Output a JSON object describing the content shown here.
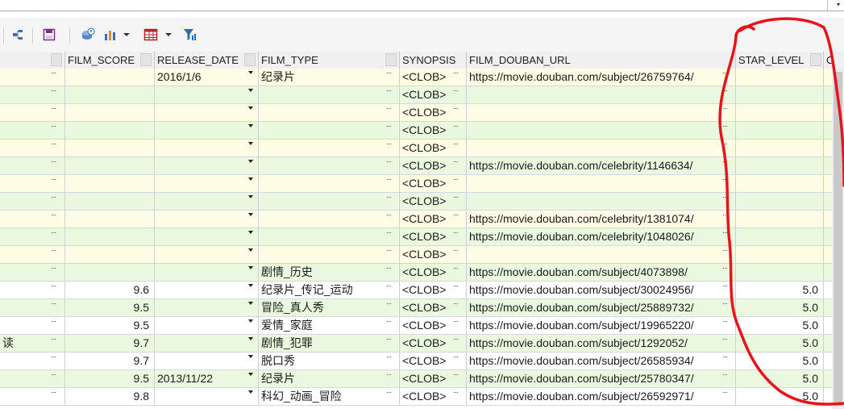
{
  "toolbar": {
    "icons": [
      "diagram-icon",
      "save-icon",
      "refresh-info-icon",
      "chart-icon",
      "dropdown-arrow-icon",
      "table-icon",
      "dropdown-arrow-icon",
      "filter-icon"
    ]
  },
  "grid": {
    "columns": [
      "FILM_SCORE",
      "RELEASE_DATE",
      "FILM_TYPE",
      "SYNOPSIS",
      "FILM_DOUBAN_URL",
      "STAR_LEVEL",
      "C"
    ],
    "rows": [
      {
        "lead": "",
        "score": "",
        "date": "2016/1/6",
        "type": "纪录片",
        "synopsis": "<CLOB>",
        "url": "https://movie.douban.com/subject/26759764/",
        "star": ""
      },
      {
        "lead": "",
        "score": "",
        "date": "",
        "type": "",
        "synopsis": "<CLOB>",
        "url": "",
        "star": ""
      },
      {
        "lead": "",
        "score": "",
        "date": "",
        "type": "",
        "synopsis": "<CLOB>",
        "url": "",
        "star": ""
      },
      {
        "lead": "",
        "score": "",
        "date": "",
        "type": "",
        "synopsis": "<CLOB>",
        "url": "",
        "star": ""
      },
      {
        "lead": "",
        "score": "",
        "date": "",
        "type": "",
        "synopsis": "<CLOB>",
        "url": "",
        "star": ""
      },
      {
        "lead": "",
        "score": "",
        "date": "",
        "type": "",
        "synopsis": "<CLOB>",
        "url": "https://movie.douban.com/celebrity/1146634/",
        "star": ""
      },
      {
        "lead": "",
        "score": "",
        "date": "",
        "type": "",
        "synopsis": "<CLOB>",
        "url": "",
        "star": ""
      },
      {
        "lead": "",
        "score": "",
        "date": "",
        "type": "",
        "synopsis": "<CLOB>",
        "url": "",
        "star": ""
      },
      {
        "lead": "",
        "score": "",
        "date": "",
        "type": "",
        "synopsis": "<CLOB>",
        "url": "https://movie.douban.com/celebrity/1381074/",
        "star": ""
      },
      {
        "lead": "",
        "score": "",
        "date": "",
        "type": "",
        "synopsis": "<CLOB>",
        "url": "https://movie.douban.com/celebrity/1048026/",
        "star": ""
      },
      {
        "lead": "",
        "score": "",
        "date": "",
        "type": "",
        "synopsis": "<CLOB>",
        "url": "",
        "star": ""
      },
      {
        "lead": "",
        "score": "",
        "date": "",
        "type": "剧情_历史",
        "synopsis": "<CLOB>",
        "url": "https://movie.douban.com/subject/4073898/",
        "star": ""
      },
      {
        "lead": "",
        "score": "9.6",
        "date": "",
        "type": "纪录片_传记_运动",
        "synopsis": "<CLOB>",
        "url": "https://movie.douban.com/subject/30024956/",
        "star": "5.0"
      },
      {
        "lead": "",
        "score": "9.5",
        "date": "",
        "type": "冒险_真人秀",
        "synopsis": "<CLOB>",
        "url": "https://movie.douban.com/subject/25889732/",
        "star": "5.0"
      },
      {
        "lead": "",
        "score": "9.5",
        "date": "",
        "type": "爱情_家庭",
        "synopsis": "<CLOB>",
        "url": "https://movie.douban.com/subject/19965220/",
        "star": "5.0"
      },
      {
        "lead": "读",
        "score": "9.7",
        "date": "",
        "type": "剧情_犯罪",
        "synopsis": "<CLOB>",
        "url": "https://movie.douban.com/subject/1292052/",
        "star": "5.0"
      },
      {
        "lead": "",
        "score": "9.7",
        "date": "",
        "type": "脱口秀",
        "synopsis": "<CLOB>",
        "url": "https://movie.douban.com/subject/26585934/",
        "star": "5.0"
      },
      {
        "lead": "",
        "score": "9.5",
        "date": "2013/11/22",
        "type": "纪录片",
        "synopsis": "<CLOB>",
        "url": "https://movie.douban.com/subject/25780347/",
        "star": "5.0"
      },
      {
        "lead": "",
        "score": "9.8",
        "date": "",
        "type": "科幻_动画_冒险",
        "synopsis": "<CLOB>",
        "url": "https://movie.douban.com/subject/26592971/",
        "star": "5.0"
      }
    ],
    "ellipsis": "···",
    "row_colors": {
      "editable": "#fdfde6",
      "fetched": "#eaf8e0",
      "white": "#ffffff"
    }
  },
  "annotation": {
    "color": "#e8141b"
  }
}
